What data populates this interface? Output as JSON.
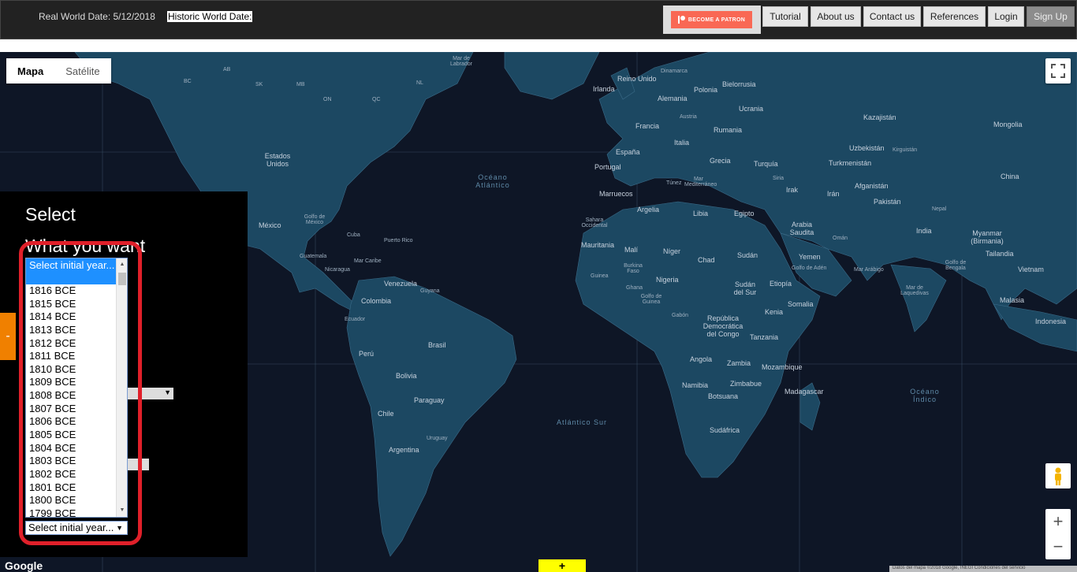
{
  "header": {
    "real_date": "Real World Date: 5/12/2018",
    "historic_date": "Historic World Date:",
    "patron_label": "BECOME A PATRON",
    "nav": [
      "Tutorial",
      "About us",
      "Contact us",
      "References",
      "Login",
      "Sign Up"
    ]
  },
  "map": {
    "type_map": "Mapa",
    "type_satellite": "Satélite",
    "google": "Google",
    "attribution": "Datos del mapa ©2018 Google, INEGI   Condiciones del servicio",
    "yellow_button": "+",
    "labels": {
      "canada_ab": "AB",
      "canada_bc": "BC",
      "canada_mb": "MB",
      "canada_sk": "SK",
      "canada_on": "ON",
      "canada_qc": "QC",
      "canada_nl": "NL",
      "estados_unidos": "Estados Unidos",
      "mexico": "México",
      "golfo_mexico": "Golfo de México",
      "cuba": "Cuba",
      "puerto_rico": "Puerto Rico",
      "guatemala": "Guatemala",
      "nicaragua": "Nicaragua",
      "mar_caribe": "Mar Caribe",
      "venezuela": "Venezuela",
      "guyana": "Guyana",
      "colombia": "Colombia",
      "ecuador": "Ecuador",
      "peru": "Perú",
      "brasil": "Brasil",
      "bolivia": "Bolivia",
      "paraguay": "Paraguay",
      "chile": "Chile",
      "argentina": "Argentina",
      "uruguay": "Uruguay",
      "mar_labrador": "Mar de Labrador",
      "oceano_atlantico": "Océano Atlántico",
      "atlantico_sur": "Atlántico Sur",
      "reino_unido": "Reino Unido",
      "irlanda": "Irlanda",
      "dinamarca": "Dinamarca",
      "alemania": "Alemania",
      "polonia": "Polonia",
      "bielorrusia": "Bielorrusia",
      "ucrania": "Ucrania",
      "francia": "Francia",
      "austria": "Austria",
      "rumania": "Rumania",
      "italia": "Italia",
      "espana": "España",
      "portugal": "Portugal",
      "grecia": "Grecia",
      "turquia": "Turquía",
      "kazajistan": "Kazajistán",
      "mongolia": "Mongolia",
      "uzbekistan": "Uzbekistán",
      "kirguistan": "Kirguistán",
      "turkmenistan": "Turkmenistán",
      "china": "China",
      "afganistan": "Afganistán",
      "iran": "Irán",
      "irak": "Irak",
      "siria": "Siria",
      "pakistan": "Pakistán",
      "nepal": "Nepal",
      "india": "India",
      "myanmar": "Myanmar (Birmania)",
      "tailandia": "Tailandia",
      "vietnam": "Vietnam",
      "malasia": "Malasia",
      "indonesia": "Indonesia",
      "mar_laquedivas": "Mar de Laquedivas",
      "golfo_bengala": "Golfo de Bengala",
      "mar_arabigo": "Mar Arábigo",
      "golfo_aden": "Golfo de Adén",
      "oman": "Omán",
      "arabia_saudita": "Arabia Saudita",
      "yemen": "Yemen",
      "tunez": "Túnez",
      "mar_mediterraneo": "Mar Mediterráneo",
      "marruecos": "Marruecos",
      "argelia": "Argelia",
      "libia": "Libia",
      "egipto": "Egipto",
      "sahara_occidental": "Sahara Occidental",
      "mauritania": "Mauritania",
      "mali": "Malí",
      "niger": "Níger",
      "chad": "Chad",
      "sudan": "Sudán",
      "burkina_faso": "Burkina Faso",
      "guinea": "Guinea",
      "ghana": "Ghana",
      "nigeria": "Nigeria",
      "sudan_sur": "Sudán del Sur",
      "etiopia": "Etiopía",
      "somalia": "Somalia",
      "golfo_guinea": "Golfo de Guinea",
      "gabon": "Gabón",
      "rep_congo": "República Democrática del Congo",
      "kenia": "Kenia",
      "tanzania": "Tanzania",
      "angola": "Angola",
      "zambia": "Zambia",
      "mozambique": "Mozambique",
      "namibia": "Namibia",
      "zimbabue": "Zimbabue",
      "botsuana": "Botsuana",
      "madagascar": "Madagascar",
      "sudafrica": "Sudáfrica",
      "oceano_indico": "Océano Índico"
    }
  },
  "panel": {
    "title": "Select",
    "subtitle": "What you want",
    "orange_tab": "-",
    "listbox": {
      "selected": "Select initial year...",
      "options": [
        "1816 BCE",
        "1815 BCE",
        "1814 BCE",
        "1813 BCE",
        "1812 BCE",
        "1811 BCE",
        "1810 BCE",
        "1809 BCE",
        "1808 BCE",
        "1807 BCE",
        "1806 BCE",
        "1805 BCE",
        "1804 BCE",
        "1803 BCE",
        "1802 BCE",
        "1801 BCE",
        "1800 BCE",
        "1799 BCE"
      ]
    },
    "dropdown_value": "Select initial year..."
  }
}
